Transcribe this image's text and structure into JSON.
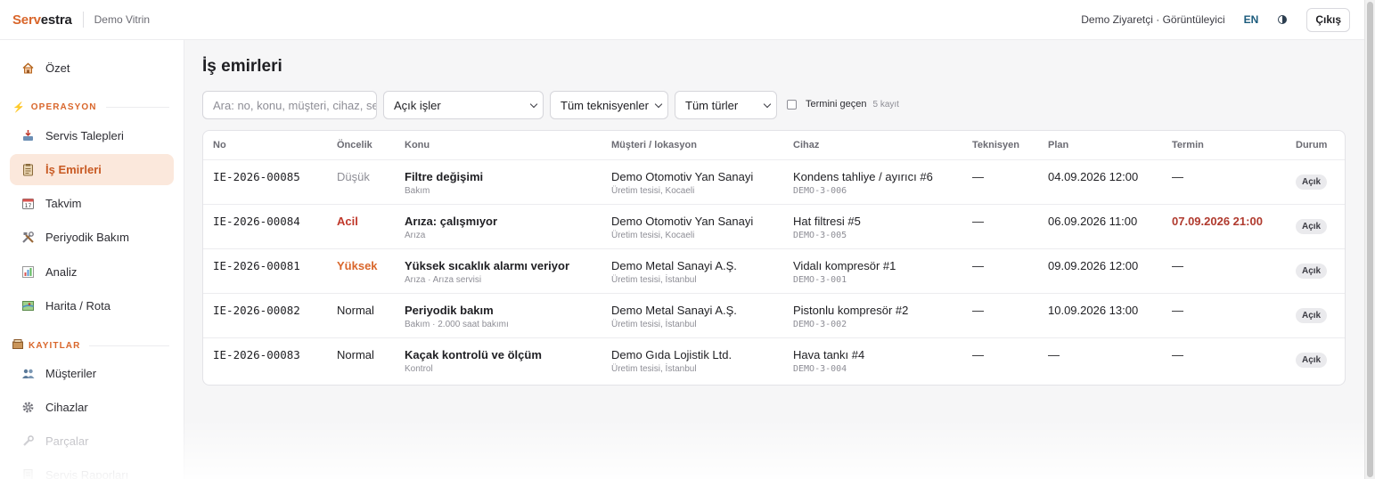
{
  "header": {
    "brand_part1": "Serv",
    "brand_part2": "estra",
    "tenant": "Demo Vitrin",
    "user": "Demo Ziyaretçi · Görüntüleyici",
    "lang": "EN",
    "theme_icon": "contrast-icon",
    "logout": "Çıkış"
  },
  "sidebar": {
    "summary": {
      "label": "Özet",
      "icon": "house-icon"
    },
    "sections": [
      {
        "title": "OPERASYON",
        "icon": "lightning-icon",
        "items": [
          {
            "label": "Servis Talepleri",
            "icon": "inbox-tray-icon"
          },
          {
            "label": "İş Emirleri",
            "icon": "clipboard-icon",
            "active": true
          },
          {
            "label": "Takvim",
            "icon": "calendar-icon"
          },
          {
            "label": "Periyodik Bakım",
            "icon": "tools-icon"
          },
          {
            "label": "Analiz",
            "icon": "bar-chart-icon"
          },
          {
            "label": "Harita / Rota",
            "icon": "map-icon"
          }
        ]
      },
      {
        "title": "KAYITLAR",
        "icon": "card-box-icon",
        "items": [
          {
            "label": "Müşteriler",
            "icon": "people-icon"
          },
          {
            "label": "Cihazlar",
            "icon": "gear-icon"
          },
          {
            "label": "Parçalar",
            "icon": "wrench-icon"
          },
          {
            "label": "Servis Raporları",
            "icon": "report-icon"
          }
        ]
      }
    ]
  },
  "main": {
    "title": "İş emirleri",
    "search_placeholder": "Ara: no, konu, müşteri, cihaz, seri",
    "filters": {
      "status": "Açık işler",
      "technician": "Tüm teknisyenler",
      "type": "Tüm türler"
    },
    "overdue_label": "Termini geçen",
    "record_count": "5 kayıt",
    "columns": [
      "No",
      "Öncelik",
      "Konu",
      "Müşteri / lokasyon",
      "Cihaz",
      "Teknisyen",
      "Plan",
      "Termin",
      "Durum"
    ],
    "rows": [
      {
        "no": "IE-2026-00085",
        "priority": "Düşük",
        "priority_level": "low",
        "subject": "Filtre değişimi",
        "subject_sub": "Bakım",
        "customer": "Demo Otomotiv Yan Sanayi",
        "location": "Üretim tesisi, Kocaeli",
        "device": "Kondens tahliye / ayırıcı #6",
        "device_code": "DEMO-3-006",
        "technician": "—",
        "plan": "04.09.2026 12:00",
        "due": "—",
        "due_overdue": false,
        "status": "Açık"
      },
      {
        "no": "IE-2026-00084",
        "priority": "Acil",
        "priority_level": "urgent",
        "subject": "Arıza: çalışmıyor",
        "subject_sub": "Arıza",
        "customer": "Demo Otomotiv Yan Sanayi",
        "location": "Üretim tesisi, Kocaeli",
        "device": "Hat filtresi #5",
        "device_code": "DEMO-3-005",
        "technician": "—",
        "plan": "06.09.2026 11:00",
        "due": "07.09.2026 21:00",
        "due_overdue": true,
        "status": "Açık"
      },
      {
        "no": "IE-2026-00081",
        "priority": "Yüksek",
        "priority_level": "high",
        "subject": "Yüksek sıcaklık alarmı veriyor",
        "subject_sub": "Arıza · Arıza servisi",
        "customer": "Demo Metal Sanayi A.Ş.",
        "location": "Üretim tesisi, İstanbul",
        "device": "Vidalı kompresör #1",
        "device_code": "DEMO-3-001",
        "technician": "—",
        "plan": "09.09.2026 12:00",
        "due": "—",
        "due_overdue": false,
        "status": "Açık"
      },
      {
        "no": "IE-2026-00082",
        "priority": "Normal",
        "priority_level": "normal",
        "subject": "Periyodik bakım",
        "subject_sub": "Bakım · 2.000 saat bakımı",
        "customer": "Demo Metal Sanayi A.Ş.",
        "location": "Üretim tesisi, İstanbul",
        "device": "Pistonlu kompresör #2",
        "device_code": "DEMO-3-002",
        "technician": "—",
        "plan": "10.09.2026 13:00",
        "due": "—",
        "due_overdue": false,
        "status": "Açık"
      },
      {
        "no": "IE-2026-00083",
        "priority": "Normal",
        "priority_level": "normal",
        "subject": "Kaçak kontrolü ve ölçüm",
        "subject_sub": "Kontrol",
        "customer": "Demo Gıda Lojistik Ltd.",
        "location": "Üretim tesisi, İstanbul",
        "device": "Hava tankı #4",
        "device_code": "DEMO-3-004",
        "technician": "—",
        "plan": "—",
        "due": "—",
        "due_overdue": false,
        "status": "Açık"
      }
    ]
  },
  "colors": {
    "brand": "#d9662b",
    "active_bg": "#fbe8dc",
    "urgent": "#c0392b",
    "overdue": "#b03a2e"
  }
}
